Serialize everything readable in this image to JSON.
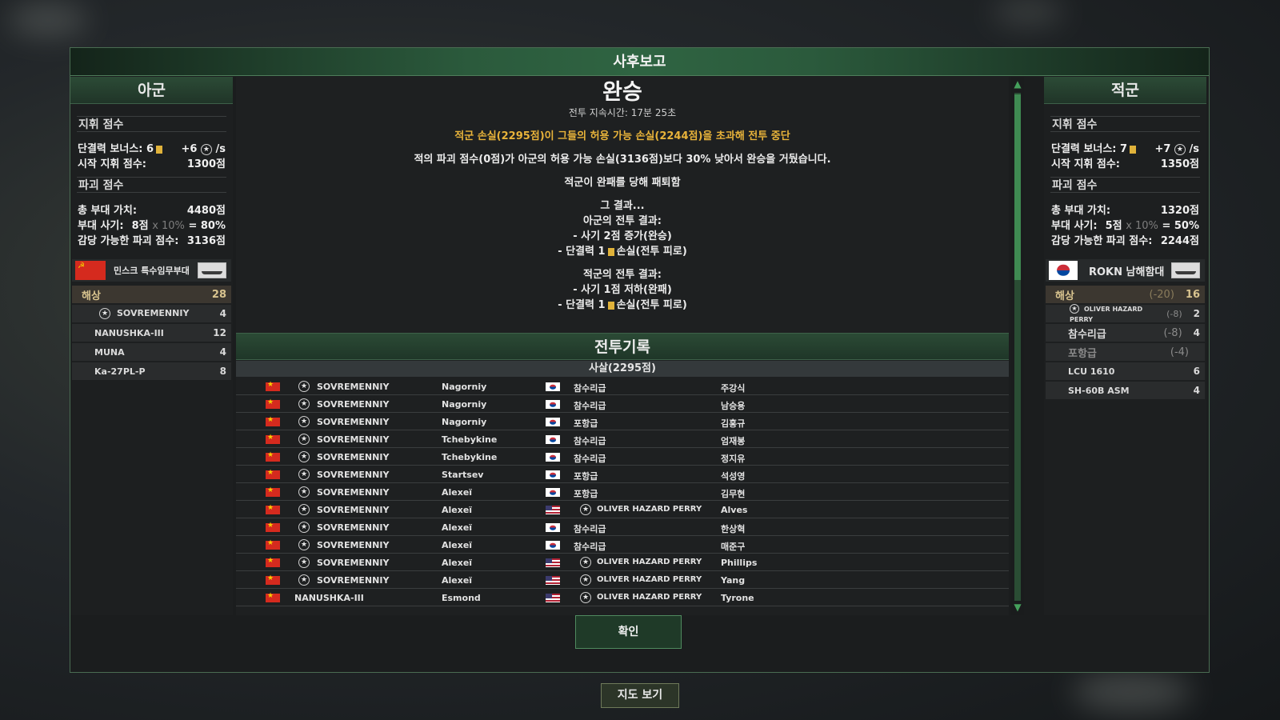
{
  "dialog": {
    "title": "사후보고",
    "confirm_label": "확인"
  },
  "map_button_label": "지도 보기",
  "ally": {
    "title": "아군",
    "command_section": "지휘 점수",
    "cohesion_label": "단결력 보너스: 6",
    "cohesion_rate": "+6",
    "cohesion_unit": "/s",
    "start_command_label": "시작 지휘 점수:",
    "start_command_value": "1300점",
    "destruction_section": "파괴 점수",
    "total_value_label": "총 부대 가치:",
    "total_value": "4480점",
    "morale_label": "부대 사기:",
    "morale_points": "8점",
    "morale_mult": "x 10%",
    "morale_result": "= 80%",
    "bearable_label": "감당 가능한 파괴 점수:",
    "bearable_value": "3136점",
    "unit_name": "민스크 특수임무부대",
    "flag": "soviet-flag",
    "category": {
      "label": "해상",
      "value": "28"
    },
    "units": [
      {
        "name": "SOVREMENNIY",
        "count": "4",
        "star": true
      },
      {
        "name": "NANUSHKA-III",
        "count": "12",
        "star": false
      },
      {
        "name": "MUNA",
        "count": "4",
        "star": false
      },
      {
        "name": "Ka-27PL-P",
        "count": "8",
        "star": false
      }
    ]
  },
  "enemy": {
    "title": "적군",
    "command_section": "지휘 점수",
    "cohesion_label": "단결력 보너스: 7",
    "cohesion_rate": "+7",
    "cohesion_unit": "/s",
    "start_command_label": "시작 지휘 점수:",
    "start_command_value": "1350점",
    "destruction_section": "파괴 점수",
    "total_value_label": "총 부대 가치:",
    "total_value": "1320점",
    "morale_label": "부대 사기:",
    "morale_points": "5점",
    "morale_mult": "x 10%",
    "morale_result": "= 50%",
    "bearable_label": "감당 가능한 파괴 점수:",
    "bearable_value": "2244점",
    "unit_name": "ROKN 남해함대",
    "flag": "korea-flag",
    "category": {
      "label": "해상",
      "penalty": "(-20)",
      "value": "16"
    },
    "units": [
      {
        "name": "OLIVER HAZARD PERRY",
        "penalty": "(-8)",
        "count": "2",
        "star": true,
        "dim": false
      },
      {
        "name": "참수리급",
        "penalty": "(-8)",
        "count": "4",
        "star": false,
        "dim": false
      },
      {
        "name": "포항급",
        "penalty": "(-4)",
        "count": "",
        "star": false,
        "dim": true
      },
      {
        "name": "LCU 1610",
        "penalty": "",
        "count": "6",
        "star": false,
        "dim": false
      },
      {
        "name": "SH-60B ASM",
        "penalty": "",
        "count": "4",
        "star": false,
        "dim": false
      }
    ]
  },
  "result": {
    "title": "완승",
    "duration": "전투 지속시간: 17분 25초",
    "stop_reason": "적군 손실(2295점)이 그들의 허용 가능 손실(2244점)을 초과해 전투 중단",
    "explanation": "적의 파괴 점수(0점)가 아군의 허용 가능 손실(3136점)보다 30% 낮아서 완승을 거뒀습니다.",
    "enemy_defeat": "적군이 완패를 당해 패퇴함",
    "consequence": "그 결과...",
    "ally_result_head": "아군의 전투 결과:",
    "ally_morale": "- 사기 2점 증가(완승)",
    "ally_cohesion_pre": "- 단결력 1",
    "ally_cohesion_post": "손실(전투 피로)",
    "enemy_result_head": "적군의 전투 결과:",
    "enemy_morale": "- 사기 1점 저하(완패)",
    "enemy_cohesion_pre": "- 단결력 1",
    "enemy_cohesion_post": "손실(전투 피로)"
  },
  "log": {
    "title": "전투기록",
    "kills_header": "사살(2295점)",
    "rows": [
      {
        "a_flag": "china-flag",
        "a_star": true,
        "a_unit": "SOVREMENNIY",
        "pilot": "Nagorniy",
        "t_flag": "korea-flag",
        "t_star": false,
        "target": "참수리급",
        "victim": "주강식"
      },
      {
        "a_flag": "china-flag",
        "a_star": true,
        "a_unit": "SOVREMENNIY",
        "pilot": "Nagorniy",
        "t_flag": "korea-flag",
        "t_star": false,
        "target": "참수리급",
        "victim": "남승용"
      },
      {
        "a_flag": "china-flag",
        "a_star": true,
        "a_unit": "SOVREMENNIY",
        "pilot": "Nagorniy",
        "t_flag": "korea-flag",
        "t_star": false,
        "target": "포항급",
        "victim": "김홍규"
      },
      {
        "a_flag": "china-flag",
        "a_star": true,
        "a_unit": "SOVREMENNIY",
        "pilot": "Tchebykine",
        "t_flag": "korea-flag",
        "t_star": false,
        "target": "참수리급",
        "victim": "엄재봉"
      },
      {
        "a_flag": "china-flag",
        "a_star": true,
        "a_unit": "SOVREMENNIY",
        "pilot": "Tchebykine",
        "t_flag": "korea-flag",
        "t_star": false,
        "target": "참수리급",
        "victim": "정지유"
      },
      {
        "a_flag": "china-flag",
        "a_star": true,
        "a_unit": "SOVREMENNIY",
        "pilot": "Startsev",
        "t_flag": "korea-flag",
        "t_star": false,
        "target": "포항급",
        "victim": "석성영"
      },
      {
        "a_flag": "china-flag",
        "a_star": true,
        "a_unit": "SOVREMENNIY",
        "pilot": "Alexeï",
        "t_flag": "korea-flag",
        "t_star": false,
        "target": "포항급",
        "victim": "김무현"
      },
      {
        "a_flag": "china-flag",
        "a_star": true,
        "a_unit": "SOVREMENNIY",
        "pilot": "Alexeï",
        "t_flag": "us-flag",
        "t_star": true,
        "target": "OLIVER HAZARD PERRY",
        "victim": "Alves"
      },
      {
        "a_flag": "china-flag",
        "a_star": true,
        "a_unit": "SOVREMENNIY",
        "pilot": "Alexeï",
        "t_flag": "korea-flag",
        "t_star": false,
        "target": "참수리급",
        "victim": "한상혁"
      },
      {
        "a_flag": "china-flag",
        "a_star": true,
        "a_unit": "SOVREMENNIY",
        "pilot": "Alexeï",
        "t_flag": "korea-flag",
        "t_star": false,
        "target": "참수리급",
        "victim": "매준구"
      },
      {
        "a_flag": "china-flag",
        "a_star": true,
        "a_unit": "SOVREMENNIY",
        "pilot": "Alexeï",
        "t_flag": "us-flag",
        "t_star": true,
        "target": "OLIVER HAZARD PERRY",
        "victim": "Phillips"
      },
      {
        "a_flag": "china-flag",
        "a_star": true,
        "a_unit": "SOVREMENNIY",
        "pilot": "Alexeï",
        "t_flag": "us-flag",
        "t_star": true,
        "target": "OLIVER HAZARD PERRY",
        "victim": "Yang"
      },
      {
        "a_flag": "china-flag",
        "a_star": false,
        "a_unit": "NANUSHKA-III",
        "pilot": "Esmond",
        "t_flag": "us-flag",
        "t_star": true,
        "target": "OLIVER HAZARD PERRY",
        "victim": "Tyrone"
      }
    ]
  },
  "colors": {
    "accent_green": "#2f6442",
    "gold": "#e8b33a",
    "panel_bg": "#1e2021"
  }
}
